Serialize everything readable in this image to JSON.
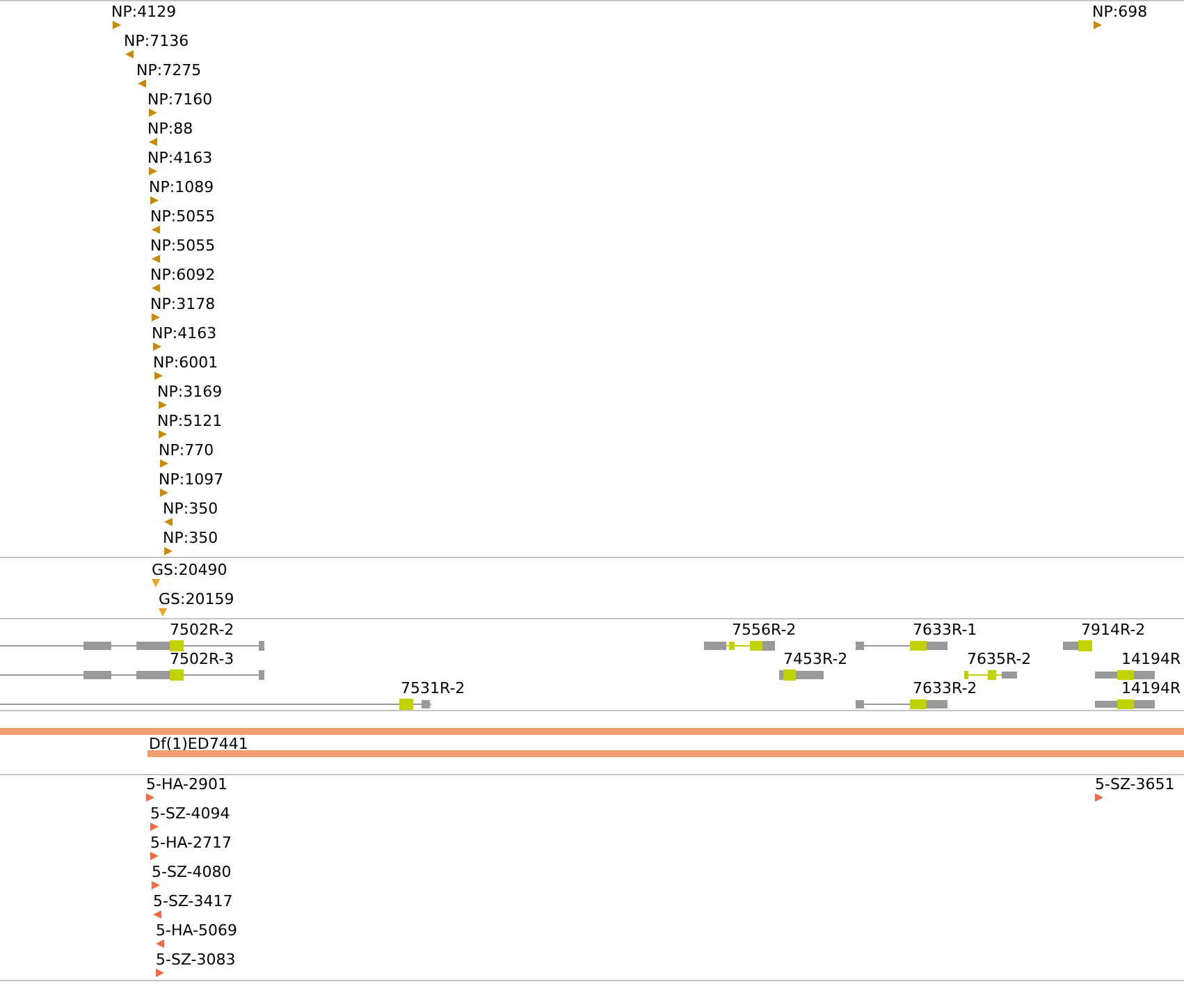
{
  "np_track": {
    "features": [
      {
        "label": "NP:4129",
        "reverse": false
      },
      {
        "label": "NP:7136",
        "reverse": true
      },
      {
        "label": "NP:7275",
        "reverse": true
      },
      {
        "label": "NP:7160",
        "reverse": false
      },
      {
        "label": "NP:88",
        "reverse": true
      },
      {
        "label": "NP:4163",
        "reverse": false
      },
      {
        "label": "NP:1089",
        "reverse": false
      },
      {
        "label": "NP:5055",
        "reverse": true
      },
      {
        "label": "NP:5055",
        "reverse": true
      },
      {
        "label": "NP:6092",
        "reverse": true
      },
      {
        "label": "NP:3178",
        "reverse": false
      },
      {
        "label": "NP:4163",
        "reverse": false
      },
      {
        "label": "NP:6001",
        "reverse": false
      },
      {
        "label": "NP:3169",
        "reverse": false
      },
      {
        "label": "NP:5121",
        "reverse": false
      },
      {
        "label": "NP:770",
        "reverse": false
      },
      {
        "label": "NP:1097",
        "reverse": false
      },
      {
        "label": "NP:350",
        "reverse": true
      },
      {
        "label": "NP:350",
        "reverse": false
      },
      {
        "label": "NP:698",
        "reverse": false
      }
    ]
  },
  "gs_track": {
    "features": [
      {
        "label": "GS:20490"
      },
      {
        "label": "GS:20159"
      }
    ]
  },
  "gene_track": {
    "transcripts": [
      {
        "label": "7502R-2"
      },
      {
        "label": "7502R-3"
      },
      {
        "label": "7531R-2"
      },
      {
        "label": "7556R-2"
      },
      {
        "label": "7453R-2"
      },
      {
        "label": "7633R-1"
      },
      {
        "label": "7635R-2"
      },
      {
        "label": "7633R-2"
      },
      {
        "label": "7914R-2"
      },
      {
        "label": "14194R"
      },
      {
        "label": "14194R"
      }
    ]
  },
  "deficiency_track": {
    "features": [
      {
        "label": "Df(1)ED7441"
      }
    ]
  },
  "insertion_track": {
    "features": [
      {
        "label": "5-HA-2901",
        "reverse": false
      },
      {
        "label": "5-SZ-4094",
        "reverse": false
      },
      {
        "label": "5-HA-2717",
        "reverse": false
      },
      {
        "label": "5-SZ-4080",
        "reverse": false
      },
      {
        "label": "5-SZ-3417",
        "reverse": true
      },
      {
        "label": "5-HA-5069",
        "reverse": true
      },
      {
        "label": "5-SZ-3083",
        "reverse": false
      },
      {
        "label": "5-SZ-3651",
        "reverse": false
      }
    ]
  }
}
